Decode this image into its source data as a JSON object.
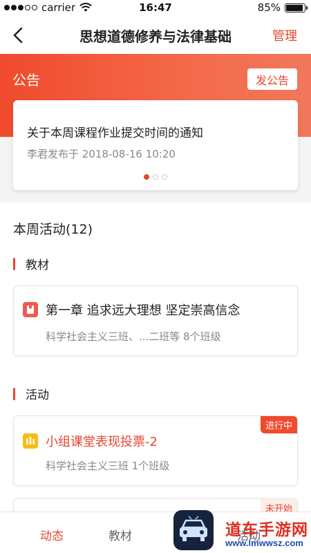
{
  "status_bar": {
    "carrier": "carrier",
    "time": "16:47",
    "battery": "85%",
    "battery_level": 0.85
  },
  "navbar": {
    "title": "思想道德修养与法律基础",
    "manage_label": "管理"
  },
  "announcement": {
    "section_title": "公告",
    "post_button": "发公告",
    "headline": "关于本周课程作业提交时间的通知",
    "meta": "李君发布于 2018-08-16 10:20",
    "pages": 3,
    "current_page": 1
  },
  "activities": {
    "title": "本周活动(12)",
    "textbook_section": "教材",
    "textbook_card": {
      "title": "第一章 追求远大理想 坚定崇高信念",
      "subtitle": "科学社会主义三班、...二班等 8个班级",
      "icon": "book-icon"
    },
    "activity_section": "活动",
    "activity_cards": [
      {
        "title": "小组课堂表现投票-2",
        "subtitle": "科学社会主义三班 1个班级",
        "status": "进行中",
        "icon": "vote-icon"
      },
      {
        "title": "",
        "subtitle": "",
        "status": "未开始",
        "icon": ""
      }
    ]
  },
  "tabbar": {
    "tabs": [
      "动态",
      "教材",
      "活动"
    ],
    "active": "动态"
  },
  "watermark": {
    "name": "道车手游网",
    "url": "www.lmwwsz.com"
  },
  "colors": {
    "accent": "#e8452f",
    "banner_start": "#f04a2d",
    "banner_end": "#f1785c"
  }
}
